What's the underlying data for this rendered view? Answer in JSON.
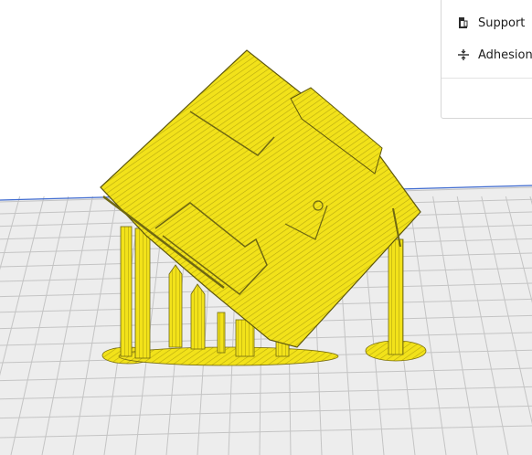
{
  "viewport": {
    "buildplate_color": "#ededed",
    "grid_color": "#c4c4c4",
    "model_color": "#f2e21a",
    "model_shadow_color": "#6f6812",
    "axis_color": "#3f6bd0"
  },
  "settings_panel": {
    "items": [
      {
        "label": "Support",
        "icon": "support-icon"
      },
      {
        "label": "Adhesion",
        "icon": "adhesion-icon"
      }
    ]
  }
}
